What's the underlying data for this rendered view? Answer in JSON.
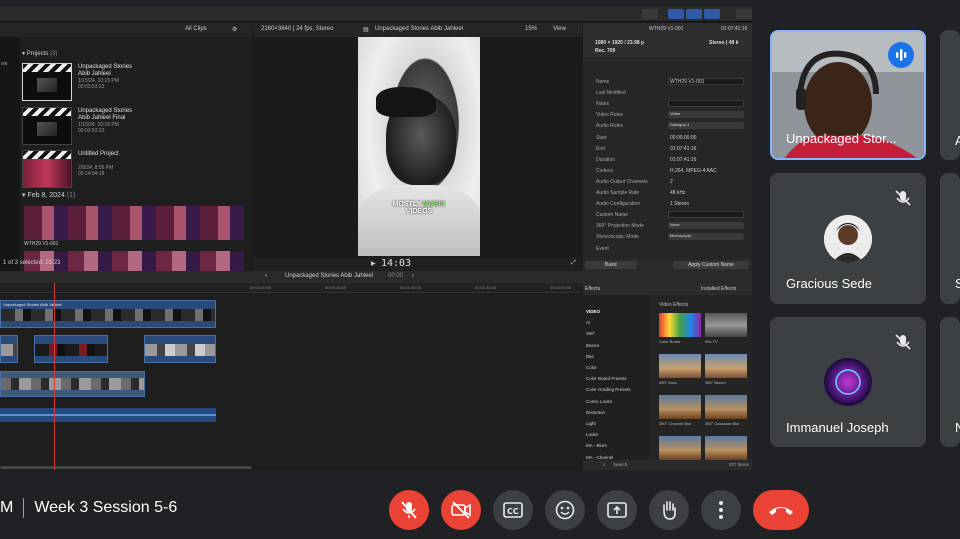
{
  "screen": {
    "browser": {
      "filter": "All Clips",
      "projects_header": "Projects",
      "projects_count": "(3)",
      "side_label": "ow",
      "clips": [
        {
          "title": "Unpackaged Stories",
          "title2": "Abib Jahleel",
          "date": "1/15/24, 10:15 PM",
          "duration": "00:03:53:23"
        },
        {
          "title": "Unpackaged Stories",
          "title2": "Abib Jahleel Final",
          "date": "1/15/24, 10:18 PM",
          "duration": "00:03:53:23"
        },
        {
          "title": "Untitled Project",
          "title2": "",
          "date": "2/8/24, 8:56 PM",
          "duration": "00:14:04:18"
        }
      ],
      "date_group": "Feb 8, 2024",
      "date_group_count": "(1)",
      "clip_label": "WTH29 V1-001",
      "footer": "1 of 3 selected, 25:23"
    },
    "viewer": {
      "format": "2160×3840 | 24 fps, Stereo",
      "title": "Unpackaged Stories Abib Jahleel",
      "zoom": "15%",
      "view_menu": "View",
      "caption_line1": "MOSTLY",
      "caption_green": "MUSIC",
      "caption_line2": "VIDEOS",
      "timecode": "14:03"
    },
    "inspector": {
      "clip_name": "WTH29 V1-001",
      "timecode_end": "01:07:41:16",
      "header_info": "1080 × 1920 / 23.98 p",
      "header_info2": "Rec. 709",
      "stereo": "Stereo | 48 k",
      "rows": [
        {
          "key": "Name",
          "value": "WTH29 V1-001",
          "kind": "box"
        },
        {
          "key": "Last Modified",
          "value": "",
          "kind": "text"
        },
        {
          "key": "Notes",
          "value": "",
          "kind": "box"
        },
        {
          "key": "Video Roles",
          "value": "Video",
          "kind": "select"
        },
        {
          "key": "Audio Roles",
          "value": "Dialogue-1",
          "kind": "select"
        },
        {
          "key": "Start",
          "value": "00:00:00:00",
          "kind": "text"
        },
        {
          "key": "End",
          "value": "01:07:41:16",
          "kind": "text"
        },
        {
          "key": "Duration",
          "value": "01:07:41:16",
          "kind": "text"
        },
        {
          "key": "Codecs",
          "value": "H.264, MPEG-4 AAC",
          "kind": "text"
        },
        {
          "key": "Audio Output Channels",
          "value": "2",
          "kind": "text"
        },
        {
          "key": "Audio Sample Rate",
          "value": "48 kHz",
          "kind": "text"
        },
        {
          "key": "Audio Configuration",
          "value": "1 Stereo",
          "kind": "text"
        },
        {
          "key": "Custom Name",
          "value": "",
          "kind": "box"
        },
        {
          "key": "360° Projection Mode",
          "value": "None",
          "kind": "select"
        },
        {
          "key": "Stereoscopic Mode",
          "value": "Monoscopic",
          "kind": "select"
        },
        {
          "key": "Event",
          "value": "",
          "kind": "text"
        }
      ],
      "basic_btn": "Basic",
      "apply_btn": "Apply Custom Name"
    },
    "timeline": {
      "title": "Unpackaged Stories Abib Jahleel",
      "time": "00:00",
      "ruler": [
        "00:00:00:00",
        "00:00:30:00",
        "00:01:00:00",
        "00:01:30:00",
        "00:02:00:00"
      ],
      "track_label": "Unpackaged Stories Abib Jahleel"
    },
    "effects": {
      "header": "Effects",
      "installed": "Installed Effects",
      "grid_title": "Video Effects",
      "categories": [
        "VIDEO",
        "AI",
        "360°",
        "Basics",
        "Blur",
        "Color",
        "Color Board Presets",
        "Color Grading Presets",
        "Comic Looks",
        "Distortion",
        "Light",
        "Looks",
        "MA - Blurs",
        "MA - Channel"
      ],
      "tiles": [
        "Color Board",
        "50s TV",
        "360° Aura",
        "360° Bloom",
        "360° Channel Blur",
        "360° Gaussian Blur"
      ],
      "search_placeholder": "Search",
      "count": "207 Items"
    }
  },
  "participants": [
    {
      "name": "Unpackaged Stor...",
      "speaking": true
    },
    {
      "name": "Gracious Sede",
      "muted": true
    },
    {
      "name": "Immanuel Joseph",
      "muted": true
    }
  ],
  "edge_letters": [
    "A",
    "S",
    "N"
  ],
  "meeting": {
    "time_fragment": "M",
    "name": "Week 3 Session 5-6"
  },
  "controls": [
    "mic-off",
    "camera-off",
    "captions",
    "emoji",
    "present",
    "raise-hand",
    "more-options",
    "leave-call"
  ],
  "colors": {
    "danger": "#ea4335",
    "control": "#3c4043",
    "active_border": "#8ab4f8",
    "speaking": "#1a73e8"
  }
}
